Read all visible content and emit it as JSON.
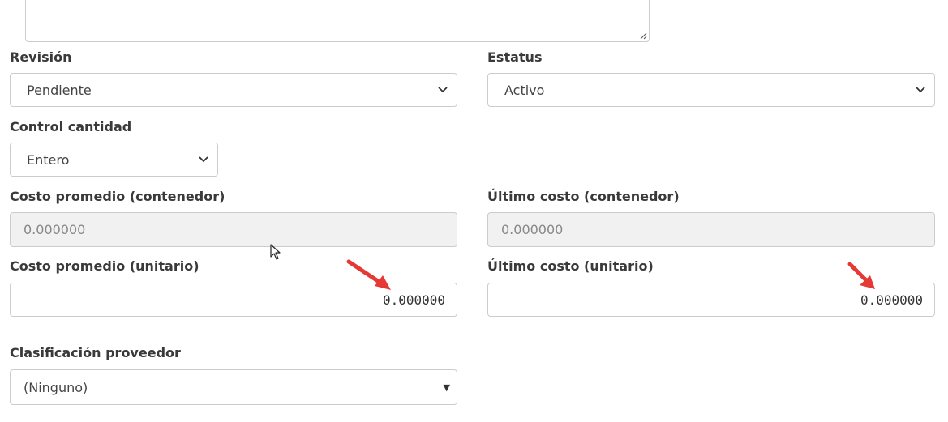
{
  "form": {
    "revision": {
      "label": "Revisión",
      "value": "Pendiente"
    },
    "estatus": {
      "label": "Estatus",
      "value": "Activo"
    },
    "control_cantidad": {
      "label": "Control cantidad",
      "value": "Entero"
    },
    "costo_promedio_contenedor": {
      "label": "Costo promedio (contenedor)",
      "value": "0.000000"
    },
    "ultimo_costo_contenedor": {
      "label": "Último costo (contenedor)",
      "value": "0.000000"
    },
    "costo_promedio_unitario": {
      "label": "Costo promedio (unitario)",
      "value": "0.000000"
    },
    "ultimo_costo_unitario": {
      "label": "Último costo (unitario)",
      "value": "0.000000"
    },
    "clasificacion_proveedor": {
      "label": "Clasificación proveedor",
      "value": "(Ninguno)"
    }
  },
  "icons": {
    "select_arrow": "chevron-down-icon",
    "combobox_arrow": "caret-down-icon",
    "annotation": "red-arrow-icon",
    "cursor": "mouse-pointer-icon"
  },
  "colors": {
    "border": "#cccccc",
    "readonly_bg": "#f1f1f1",
    "annotation_arrow": "#e53935"
  }
}
